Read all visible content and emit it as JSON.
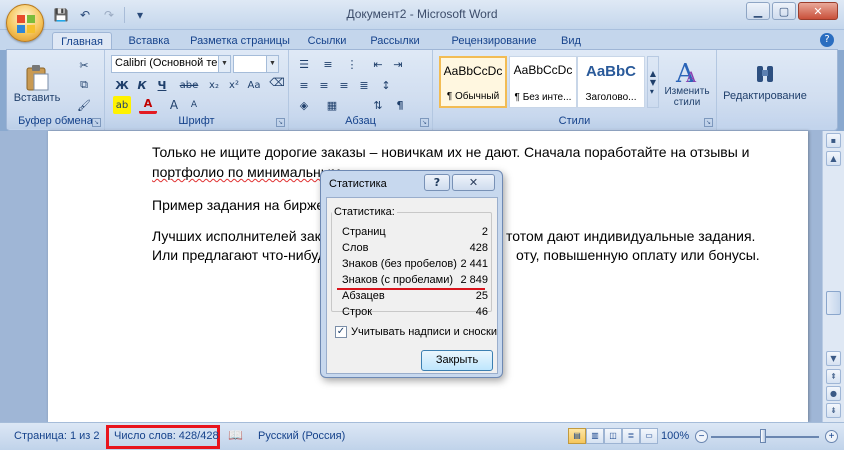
{
  "window": {
    "title": "Документ2 - Microsoft Word",
    "controls": {
      "minimize": "▁",
      "maximize": "▢",
      "close": "✕"
    }
  },
  "qat": {
    "save": "💾",
    "undo": "↶",
    "redo": "↷",
    "more": "▾"
  },
  "tabs": [
    {
      "label": "Главная",
      "active": true
    },
    {
      "label": "Вставка"
    },
    {
      "label": "Разметка страницы"
    },
    {
      "label": "Ссылки"
    },
    {
      "label": "Рассылки"
    },
    {
      "label": "Рецензирование"
    },
    {
      "label": "Вид"
    }
  ],
  "ribbon": {
    "clipboard": {
      "label": "Буфер обмена",
      "paste": "Вставить"
    },
    "font": {
      "label": "Шрифт",
      "font_name": "Calibri (Основной те",
      "font_size": "",
      "bold": "Ж",
      "italic": "К",
      "underline": "Ч",
      "strike": "abe",
      "subscript": "x₂",
      "superscript": "x²",
      "case": "Aa",
      "highlight": "ab",
      "color": "A",
      "grow": "A",
      "shrink": "A"
    },
    "paragraph": {
      "label": "Абзац",
      "pilcrow": "¶"
    },
    "styles": {
      "label": "Стили",
      "items": [
        {
          "sample": "AaBbCcDc",
          "name": "¶ Обычный"
        },
        {
          "sample": "AaBbCcDc",
          "name": "¶ Без инте..."
        },
        {
          "sample": "AaBbC",
          "name": "Заголово..."
        }
      ],
      "change_styles": "Изменить стили"
    },
    "editing": {
      "label": "Редактирование"
    }
  },
  "document": {
    "lines": [
      "Только не ищите дорогие заказы – новичкам их не дают. Сначала поработайте на отзывы и",
      "портфолио по минимальным",
      "Пример задания на бирже:",
      "Лучших исполнителей заказч",
      "тотом дают индивидуальные задания.",
      "Или предлагают что-нибудь",
      "оту, повышенную оплату или бонусы."
    ]
  },
  "dialog": {
    "title": "Статистика",
    "help": "?",
    "group_label": "Статистика:",
    "rows": [
      {
        "label": "Страниц",
        "value": "2"
      },
      {
        "label": "Слов",
        "value": "428"
      },
      {
        "label": "Знаков (без пробелов)",
        "value": "2 441"
      },
      {
        "label": "Знаков (с пробелами)",
        "value": "2 849"
      },
      {
        "label": "Абзацев",
        "value": "25"
      },
      {
        "label": "Строк",
        "value": "46"
      }
    ],
    "checkbox_label": "Учитывать надписи и сноски",
    "checkbox_checked": true,
    "close_button": "Закрыть"
  },
  "status": {
    "page": "Страница: 1 из 2",
    "words": "Число слов: 428/428",
    "language": "Русский (Россия)",
    "zoom": "100%"
  }
}
